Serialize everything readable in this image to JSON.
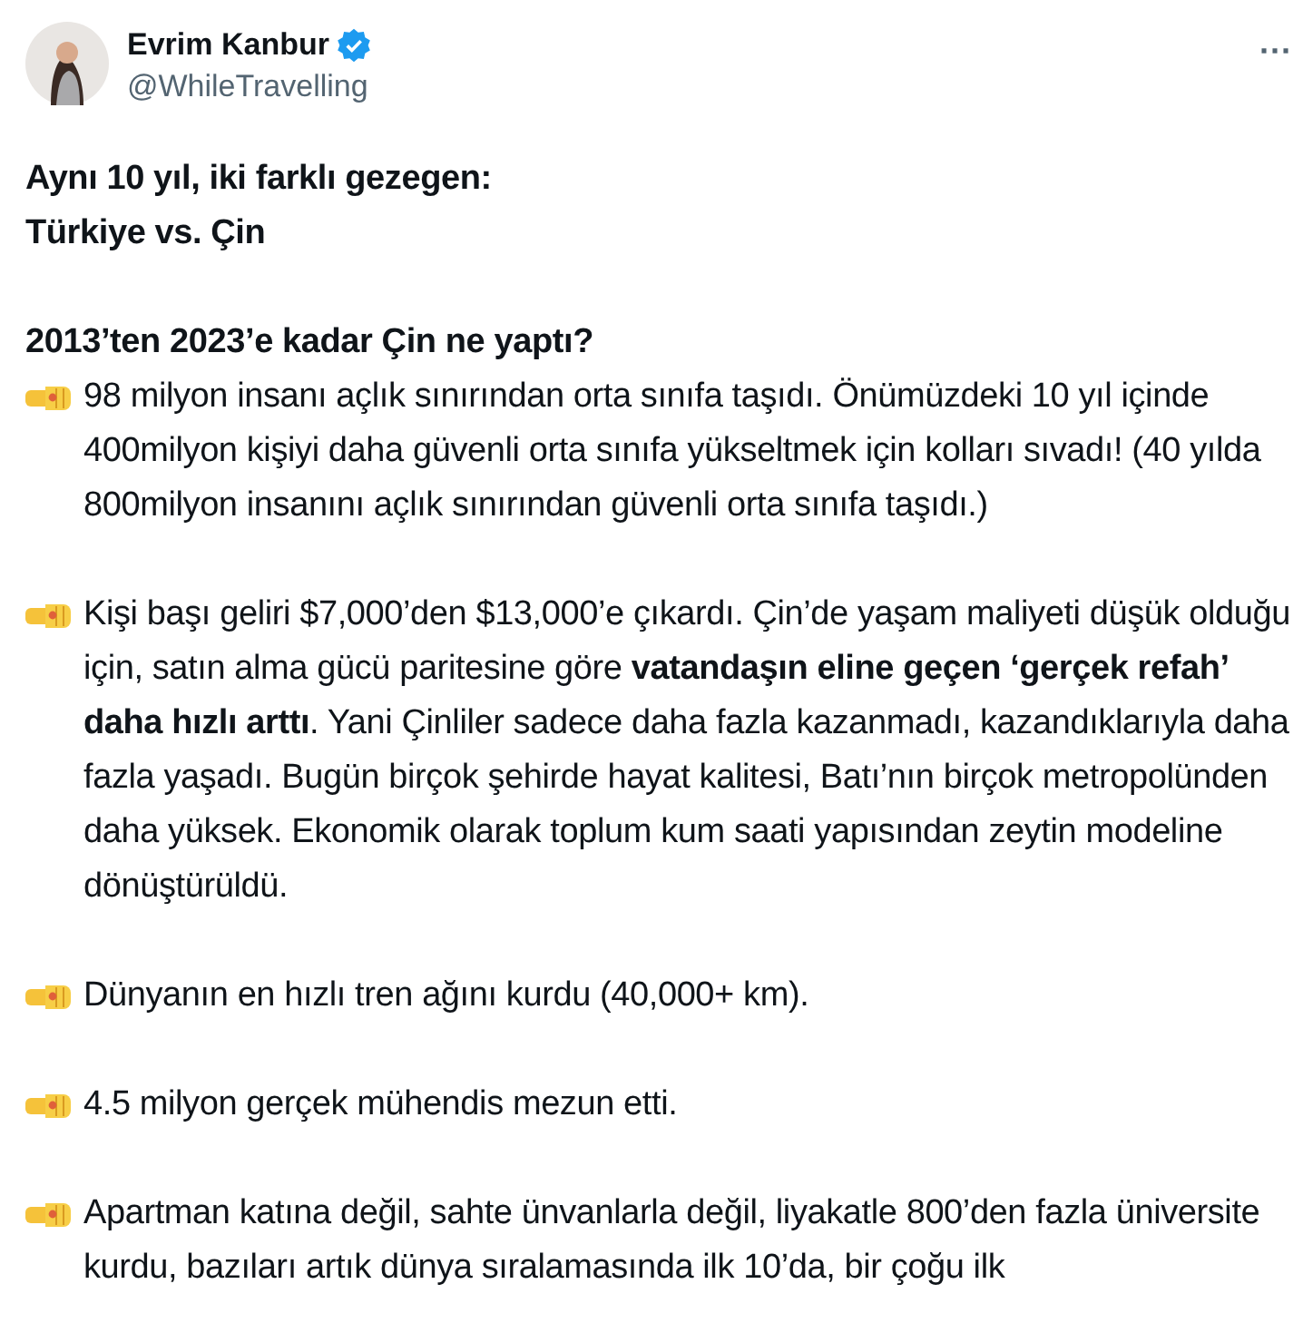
{
  "author": {
    "name": "Evrim Kanbur",
    "verified": true,
    "handle": "@WhileTravelling"
  },
  "more_button": "···",
  "blocks": [
    {
      "kind": "title",
      "text": "Aynı 10 yıl, iki farklı gezegen:\nTürkiye vs. Çin"
    },
    {
      "kind": "heading",
      "text": "2013’ten 2023’e kadar Çin ne yaptı?"
    },
    {
      "kind": "bullet",
      "text": "98 milyon insanı açlık sınırından orta sınıfa taşıdı. Önümüzdeki 10 yıl içinde 400milyon kişiyi daha güvenli orta sınıfa yükseltmek için kolları sıvadı! (40 yılda 800milyon insanını açlık sınırından güvenli orta sınıfa taşıdı.)"
    },
    {
      "kind": "bullet",
      "text": "Kişi başı geliri $7,000’den $13,000’e çıkardı. Çin’de yaşam maliyeti düşük olduğu için, satın alma gücü paritesine göre **vatandaşın eline geçen ‘gerçek refah’ daha hızlı arttı**. Yani Çinliler sadece daha fazla kazanmadı, kazandıklarıyla daha fazla yaşadı. Bugün birçok şehirde hayat kalitesi, Batı’nın birçok metropolünden daha yüksek. Ekonomik olarak toplum kum saati yapısından zeytin modeline dönüştürüldü."
    },
    {
      "kind": "bullet",
      "text": "Dünyanın en hızlı tren ağını kurdu (40,000+ km)."
    },
    {
      "kind": "bullet",
      "text": "4.5 milyon gerçek mühendis mezun etti."
    },
    {
      "kind": "bullet",
      "text": "Apartman katına değil, sahte ünvanlarla değil, liyakatle 800’den fazla üniversite kurdu, bazıları artık dünya sıralamasında ilk 10’da, bir çoğu ilk"
    }
  ]
}
